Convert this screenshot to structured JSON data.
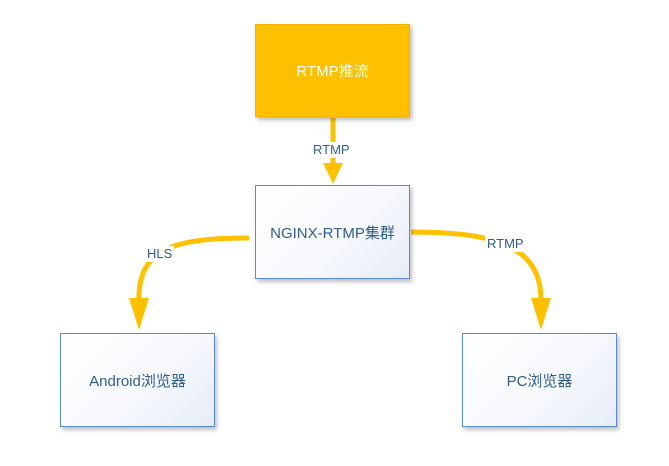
{
  "nodes": {
    "source": "RTMP推流",
    "cluster": "NGINX-RTMP集群",
    "android": "Android浏览器",
    "pc": "PC浏览器"
  },
  "edges": {
    "source_to_cluster": "RTMP",
    "cluster_to_android": "HLS",
    "cluster_to_pc": "RTMP"
  },
  "colors": {
    "source_fill": "#ffc000",
    "arrow": "#ffc000",
    "box_border": "#5b8bc9",
    "text_blue": "#2f5d8c"
  }
}
